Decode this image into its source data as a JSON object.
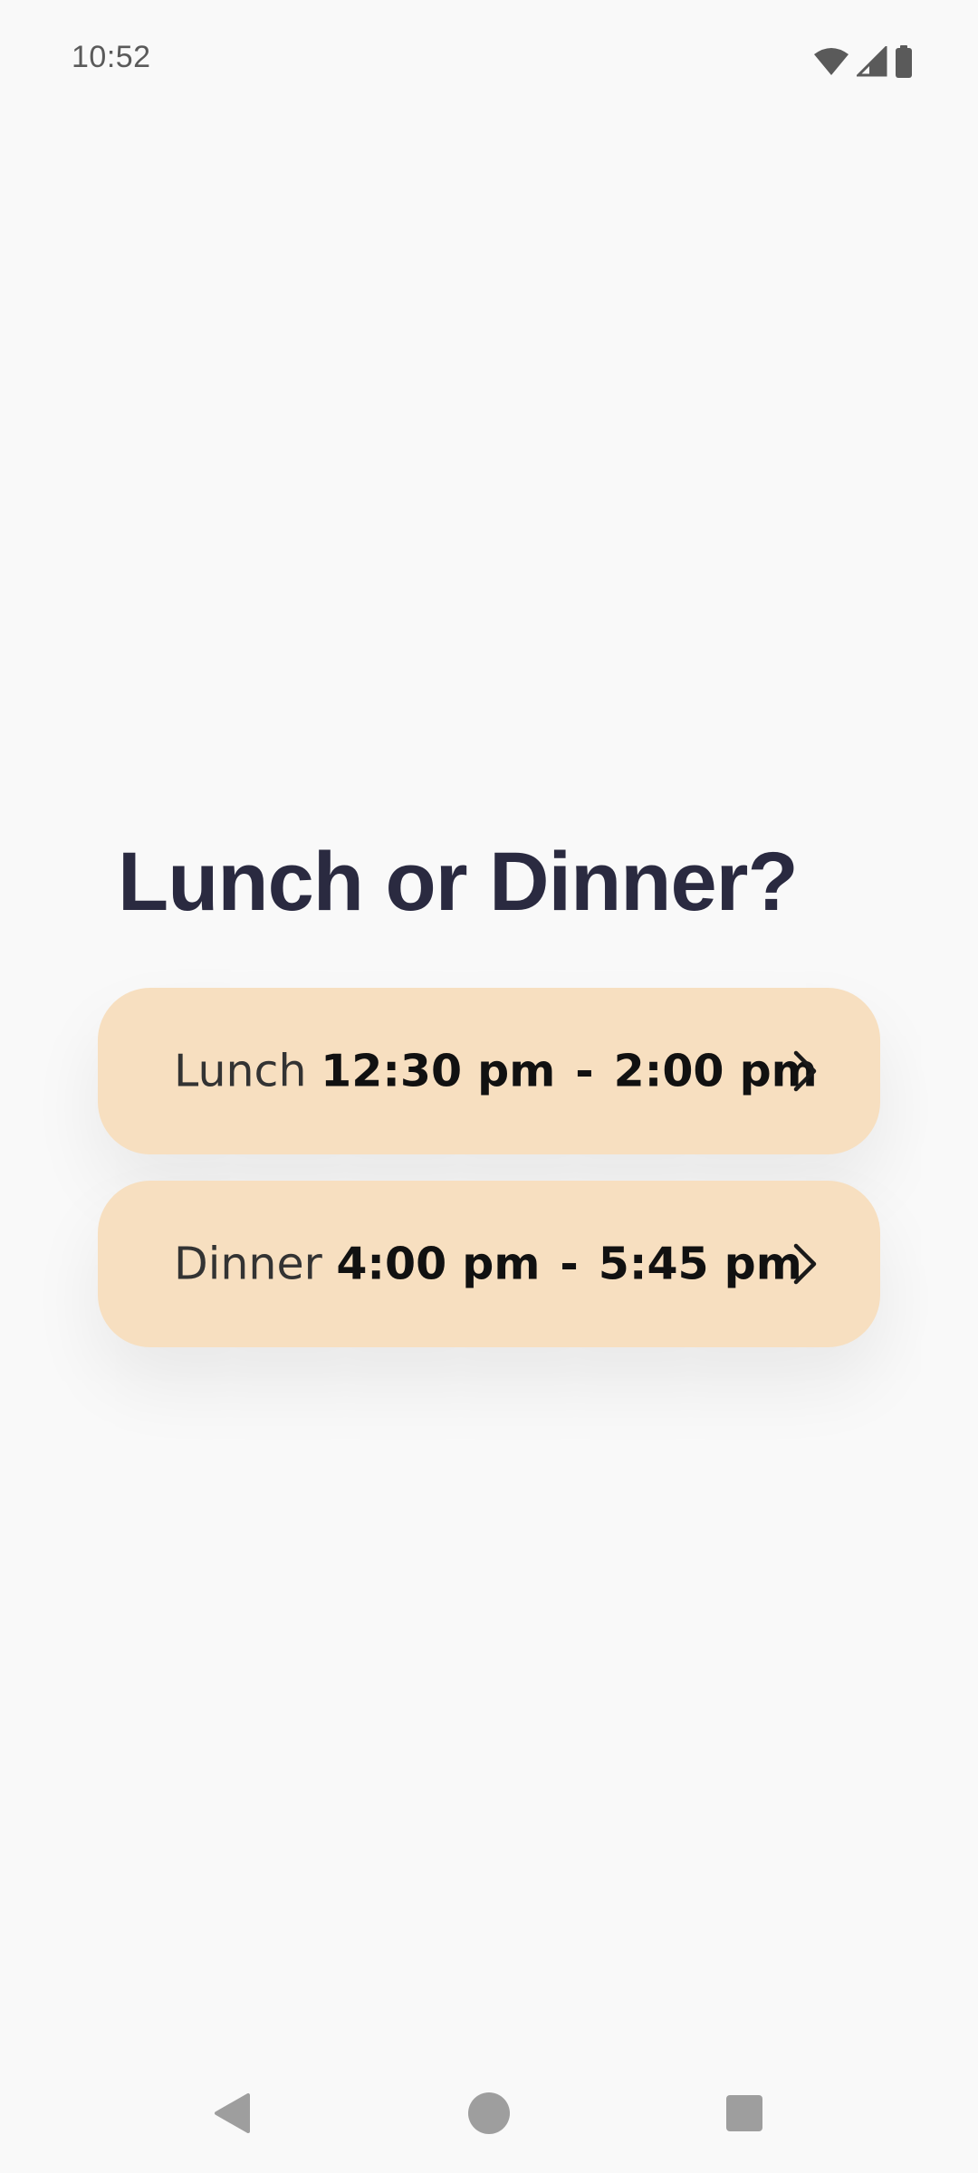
{
  "status_bar": {
    "time": "10:52",
    "icons": [
      "wifi-icon",
      "cellular-signal-icon",
      "battery-icon"
    ]
  },
  "title": "Lunch or Dinner?",
  "options": [
    {
      "name": "Lunch",
      "start": "12:30 pm",
      "separator": "-",
      "end": "2:00 pm",
      "icon": "chevron-right-icon"
    },
    {
      "name": "Dinner",
      "start": "4:00 pm",
      "separator": "-",
      "end": "5:45 pm",
      "icon": "chevron-right-icon"
    }
  ],
  "colors": {
    "background": "#f9f9f9",
    "card": "#f7dfc0",
    "title": "#2a2a40",
    "nav_icon": "#9e9e9e"
  },
  "nav_bar": {
    "icons": [
      "back-icon",
      "home-icon",
      "recents-icon"
    ]
  }
}
